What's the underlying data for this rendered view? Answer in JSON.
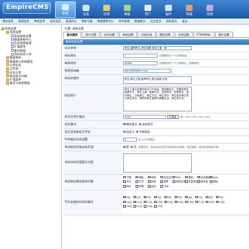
{
  "app": {
    "logo": "EmpireCMS"
  },
  "topnav": [
    {
      "label": "系统",
      "active": true
    },
    {
      "label": "信息",
      "active": false
    },
    {
      "label": "栏目",
      "active": false
    },
    {
      "label": "模板",
      "active": false
    },
    {
      "label": "用户",
      "active": false
    },
    {
      "label": "插件",
      "active": false
    },
    {
      "label": "商城",
      "active": false
    },
    {
      "label": "其他",
      "active": false
    }
  ],
  "subnav": [
    "增加信息",
    "管理信息",
    "审核信息",
    "签发信息",
    "管理评论",
    "更新专题",
    "数据更新中心",
    "附件管理",
    "数据统计",
    "后台首页",
    "网站首页",
    "退出"
  ],
  "sidebar": [
    {
      "level": 1,
      "icon": "folder",
      "label": "系统设置"
    },
    {
      "level": 2,
      "icon": "folder",
      "label": "系统设置"
    },
    {
      "level": 3,
      "icon": "page",
      "label": "系统参数设置"
    },
    {
      "level": 3,
      "icon": "page",
      "label": "数据更新中心"
    },
    {
      "level": 3,
      "icon": "page",
      "label": "后台地图管理"
    },
    {
      "level": 3,
      "icon": "page",
      "label": "扩展菜单"
    },
    {
      "level": 3,
      "icon": "page",
      "label": "备份数据"
    },
    {
      "level": 3,
      "icon": "page",
      "label": "网站动态入场"
    },
    {
      "level": 2,
      "icon": "folder",
      "label": "数据更新"
    },
    {
      "level": 2,
      "icon": "folder",
      "label": "数据表与系统模型"
    },
    {
      "level": 2,
      "icon": "folder",
      "label": "计划任务"
    },
    {
      "level": 2,
      "icon": "folder",
      "label": "工作流"
    },
    {
      "level": 2,
      "icon": "folder",
      "label": "优化方案"
    },
    {
      "level": 2,
      "icon": "folder",
      "label": "网站多访问端"
    },
    {
      "level": 2,
      "icon": "folder",
      "label": "扩展菜单"
    },
    {
      "level": 2,
      "icon": "folder",
      "label": "备份与恢复数据"
    }
  ],
  "main": {
    "breadcrumb": "位置: 参数设置",
    "tabs": [
      {
        "label": "基本属性",
        "active": true
      },
      {
        "label": "用户设置",
        "active": false
      },
      {
        "label": "文件设置",
        "active": false
      },
      {
        "label": "其他设置",
        "active": false
      },
      {
        "label": "分组生成",
        "active": false
      },
      {
        "label": "模型设置",
        "active": false
      },
      {
        "label": "信息设置",
        "active": false
      },
      {
        "label": "FTP/EMAIL",
        "active": false
      },
      {
        "label": "图片设置",
        "active": false
      }
    ],
    "section_title": "基本信息设置",
    "fields": {
      "site_name_label": "站点名称",
      "site_name_value": "养生_营养养生_养生保健_养生之道 - 养",
      "site_url_label": "网站地址",
      "site_url_value": "/",
      "site_url_hint": "(如需更改为一个正确地址)",
      "news_url_label": "新闻地址",
      "news_url_value": "/d/file/",
      "news_url_hint": "(如需更改为一个正确地址，结尾需加)",
      "admin_email_label": "管理员邮箱",
      "admin_email_value": "admin@admin.com",
      "keywords_label": "网站关键字",
      "keywords_value": "养生,养生之道,营养养生,养生保健,饮食",
      "desc_label": "网站简介",
      "desc_value": "养生之道为您提供养生门户网站，提供最专业，完善的养生保健方法，养生之道，保健方法，饮食养生，四季养生，食疗养生，中医养生，养生方法，养生常识，养生知识等文章与养生资讯，帮助你养生保健与健康生活，养生有方法。",
      "index_file_label": "首页文件扩展名",
      "index_file_value": ".html",
      "index_file_btn": "扩展名",
      "index_file_hint": "(如: .html,.htm,.xml,.php)",
      "index_mode_label": "首页模式",
      "index_mode_opts": [
        "静态首页",
        "动态首页"
      ],
      "index_dir_label": "首页目录绑定文件名",
      "index_dir_opts": [
        "自定义",
        "不做绑定"
      ],
      "php_time_label": "PHP超时时间设置",
      "php_time_value": "0",
      "php_time_hint": "秒 (0为不限制)",
      "close_site_label": "关闭前台所有动态页面",
      "close_site_opts": [
        "是",
        "否"
      ],
      "close_site_hint": "(如果关闭，前台前台动态文件都将无法使用，包括搜索，留言反馈等会员等)",
      "close_tip_label": "关闭动态页面提示内容",
      "close_modules_label": "关闭前台模块相关功能",
      "close_modules": [
        "下载",
        "电影",
        "商城",
        "在线支付",
        "RSS",
        "搜索",
        "全站搜索",
        "Ajax",
        "评论",
        "打印",
        "标签",
        "投票",
        "信息反馈",
        "信息提交",
        "留言板",
        "链接",
        "附件",
        "专题",
        "会员",
        "订阅"
      ],
      "func_label": "不开启操作时间的操作",
      "func_items": [
        "0点",
        "1点",
        "2点",
        "3点",
        "4点",
        "5点",
        "6点",
        "7点",
        "8点",
        "9点",
        "10点",
        "11点",
        "12点",
        "13点",
        "14点",
        "15点",
        "16点",
        "17点",
        "18点",
        "19点",
        "20点",
        "21点",
        "22点",
        "23点"
      ]
    }
  }
}
